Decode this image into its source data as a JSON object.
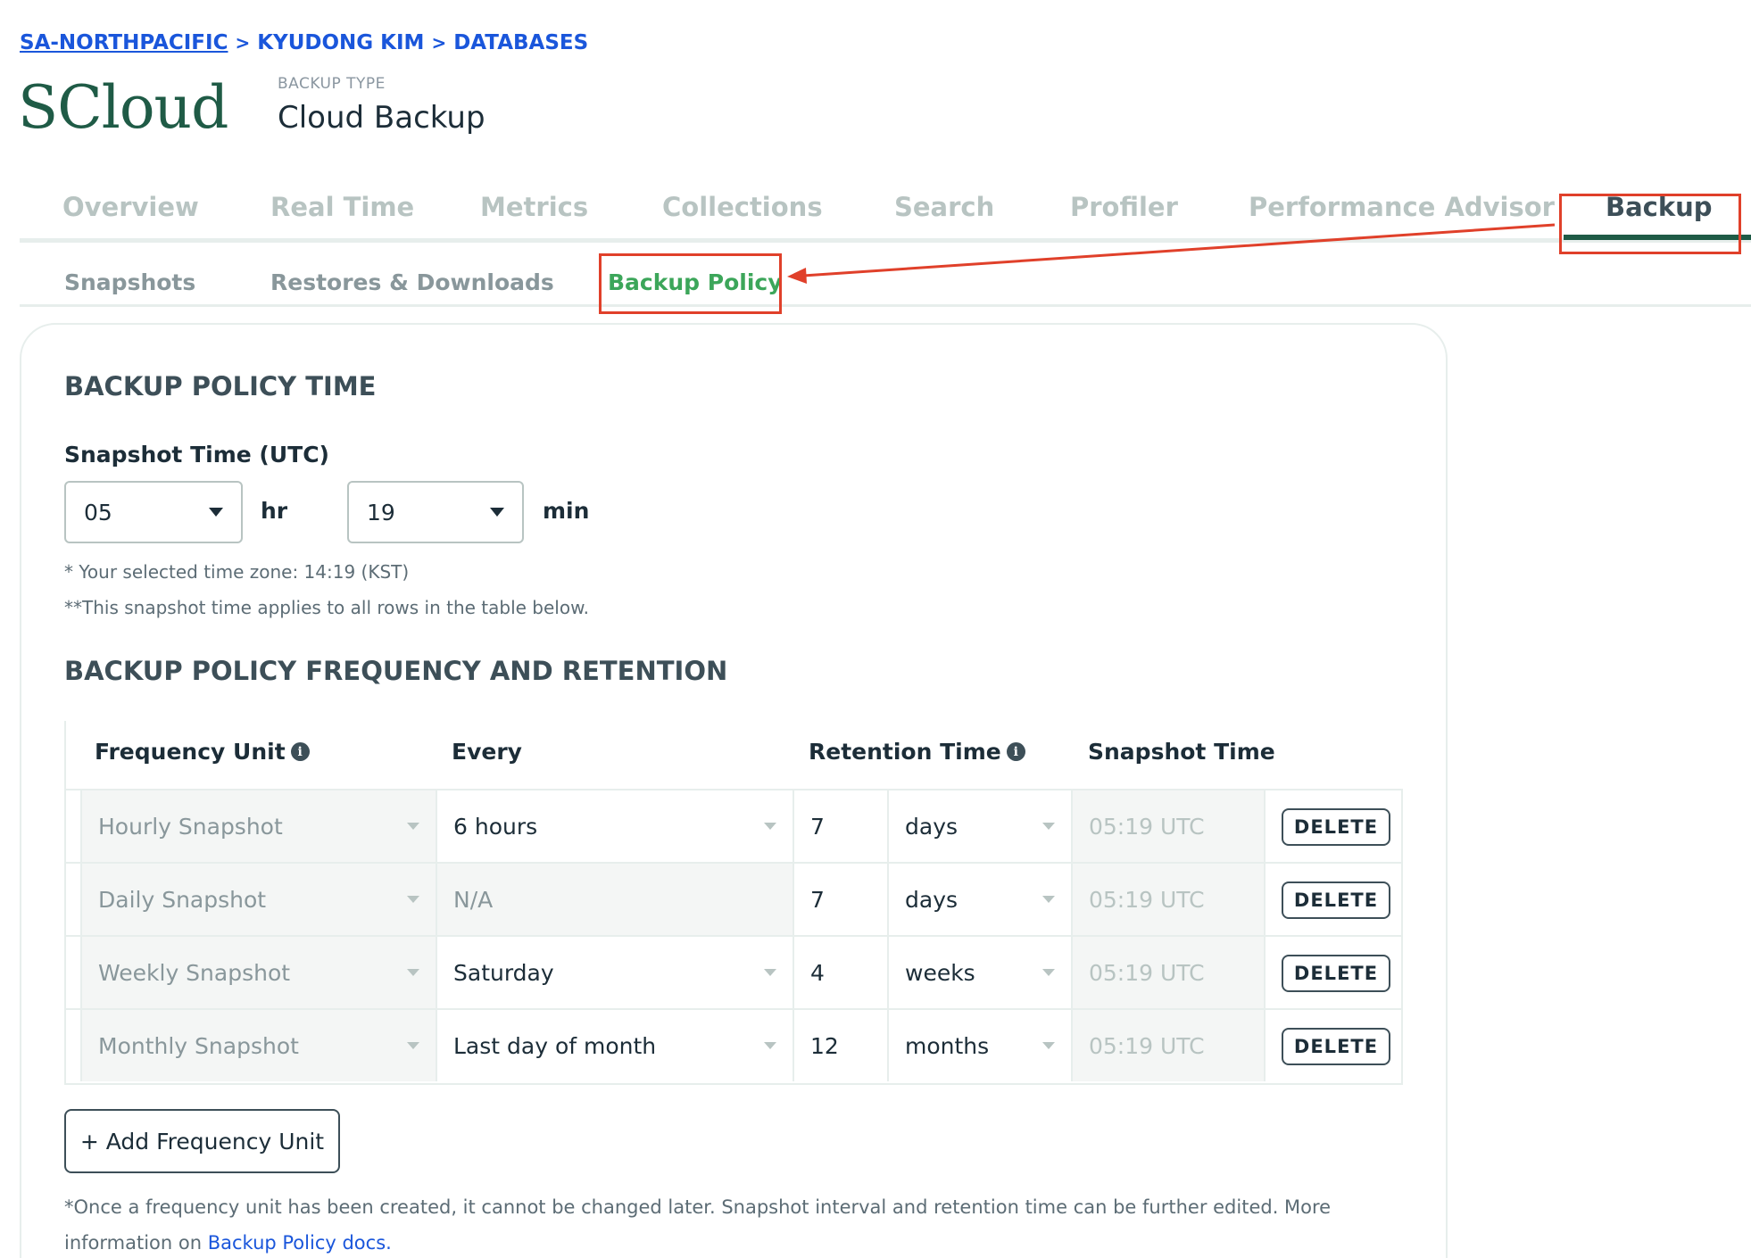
{
  "breadcrumb": {
    "items": [
      "SA-NORTHPACIFIC",
      "KYUDONG KIM",
      "DATABASES"
    ],
    "separator": ">"
  },
  "logo": "SCloud",
  "backup_type": {
    "label": "BACKUP TYPE",
    "value": "Cloud Backup"
  },
  "tabs": [
    "Overview",
    "Real Time",
    "Metrics",
    "Collections",
    "Search",
    "Profiler",
    "Performance Advisor",
    "Backup"
  ],
  "active_tab": "Backup",
  "subtabs": [
    "Snapshots",
    "Restores & Downloads",
    "Backup Policy"
  ],
  "active_subtab": "Backup Policy",
  "policy_time": {
    "heading": "BACKUP POLICY TIME",
    "snapshot_label": "Snapshot Time (UTC)",
    "hour_value": "05",
    "hour_unit": "hr",
    "minute_value": "19",
    "minute_unit": "min",
    "note1": "* Your selected time zone: 14:19 (KST)",
    "note2": "**This snapshot time applies to all rows in the table below."
  },
  "frequency": {
    "heading": "BACKUP POLICY FREQUENCY AND RETENTION",
    "columns": [
      "Frequency Unit",
      "Every",
      "Retention Time",
      "Snapshot Time"
    ],
    "rows": [
      {
        "unit": "Hourly Snapshot",
        "every": "6 hours",
        "retention_value": "7",
        "retention_unit": "days",
        "snapshot_time": "05:19 UTC",
        "action": "DELETE"
      },
      {
        "unit": "Daily Snapshot",
        "every": "N/A",
        "retention_value": "7",
        "retention_unit": "days",
        "snapshot_time": "05:19 UTC",
        "action": "DELETE"
      },
      {
        "unit": "Weekly Snapshot",
        "every": "Saturday",
        "retention_value": "4",
        "retention_unit": "weeks",
        "snapshot_time": "05:19 UTC",
        "action": "DELETE"
      },
      {
        "unit": "Monthly Snapshot",
        "every": "Last day of month",
        "retention_value": "12",
        "retention_unit": "months",
        "snapshot_time": "05:19 UTC",
        "action": "DELETE"
      }
    ],
    "add_button": "+ Add Frequency Unit",
    "footnote_text": "*Once a frequency unit has been created, it cannot be changed later. Snapshot interval and retention time can be further edited. More information on",
    "footnote_link": "Backup Policy docs."
  },
  "colors": {
    "brand": "#1f5b46",
    "link": "#1a56db",
    "active_subtab": "#3ca65a",
    "annotation": "#e0402a"
  }
}
